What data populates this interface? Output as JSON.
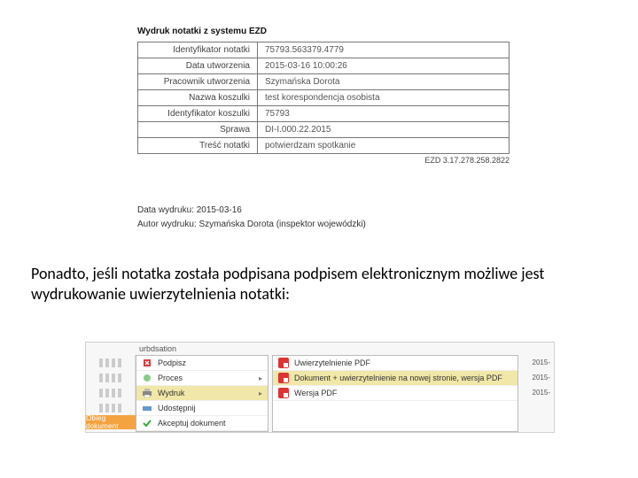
{
  "print": {
    "title": "Wydruk notatki z systemu EZD",
    "rows": [
      {
        "label": "Identyfikator notatki",
        "value": "75793.563379.4779"
      },
      {
        "label": "Data utworzenia",
        "value": "2015-03-16 10:00:26"
      },
      {
        "label": "Pracownik utworzenia",
        "value": "Szymańska Dorota"
      },
      {
        "label": "Nazwa koszulki",
        "value": "test korespondencja osobista"
      },
      {
        "label": "Identyfikator koszulki",
        "value": "75793"
      },
      {
        "label": "Sprawa",
        "value": "DI-I.000.22.2015"
      },
      {
        "label": "Treść notatki",
        "value": "potwierdzam spotkanie"
      }
    ],
    "footer": "EZD 3.17.278.258.2822"
  },
  "meta": {
    "date_line": "Data wydruku: 2015-03-16",
    "author_line": "Autor wydruku: Szymańska Dorota (inspektor wojewódzki)"
  },
  "paragraph": "Ponadto, jeśli notatka została podpisana podpisem elektronicznym możliwe jest wydrukowanie uwierzytelnienia notatki:",
  "ui": {
    "crumb": "urbdsation",
    "tag": "Obieg dokument",
    "year_col": [
      "2015-",
      "2015-",
      "2015-"
    ],
    "menu": [
      {
        "label": "Podpisz",
        "icon": "sign-icon",
        "arrow": false,
        "hl": false
      },
      {
        "label": "Proces",
        "icon": "process-icon",
        "arrow": true,
        "hl": false
      },
      {
        "label": "Wydruk",
        "icon": "print-icon",
        "arrow": true,
        "hl": true
      },
      {
        "label": "Udostępnij",
        "icon": "share-icon",
        "arrow": false,
        "hl": false
      },
      {
        "label": "Akceptuj dokument",
        "icon": "accept-icon",
        "arrow": false,
        "hl": false
      }
    ],
    "submenu": [
      {
        "label": "Uwierzytelnienie PDF",
        "hl": false
      },
      {
        "label": "Dokument + uwierzytelnienie na nowej stronie, wersja PDF",
        "hl": true
      },
      {
        "label": "Wersja PDF",
        "hl": false
      }
    ]
  }
}
